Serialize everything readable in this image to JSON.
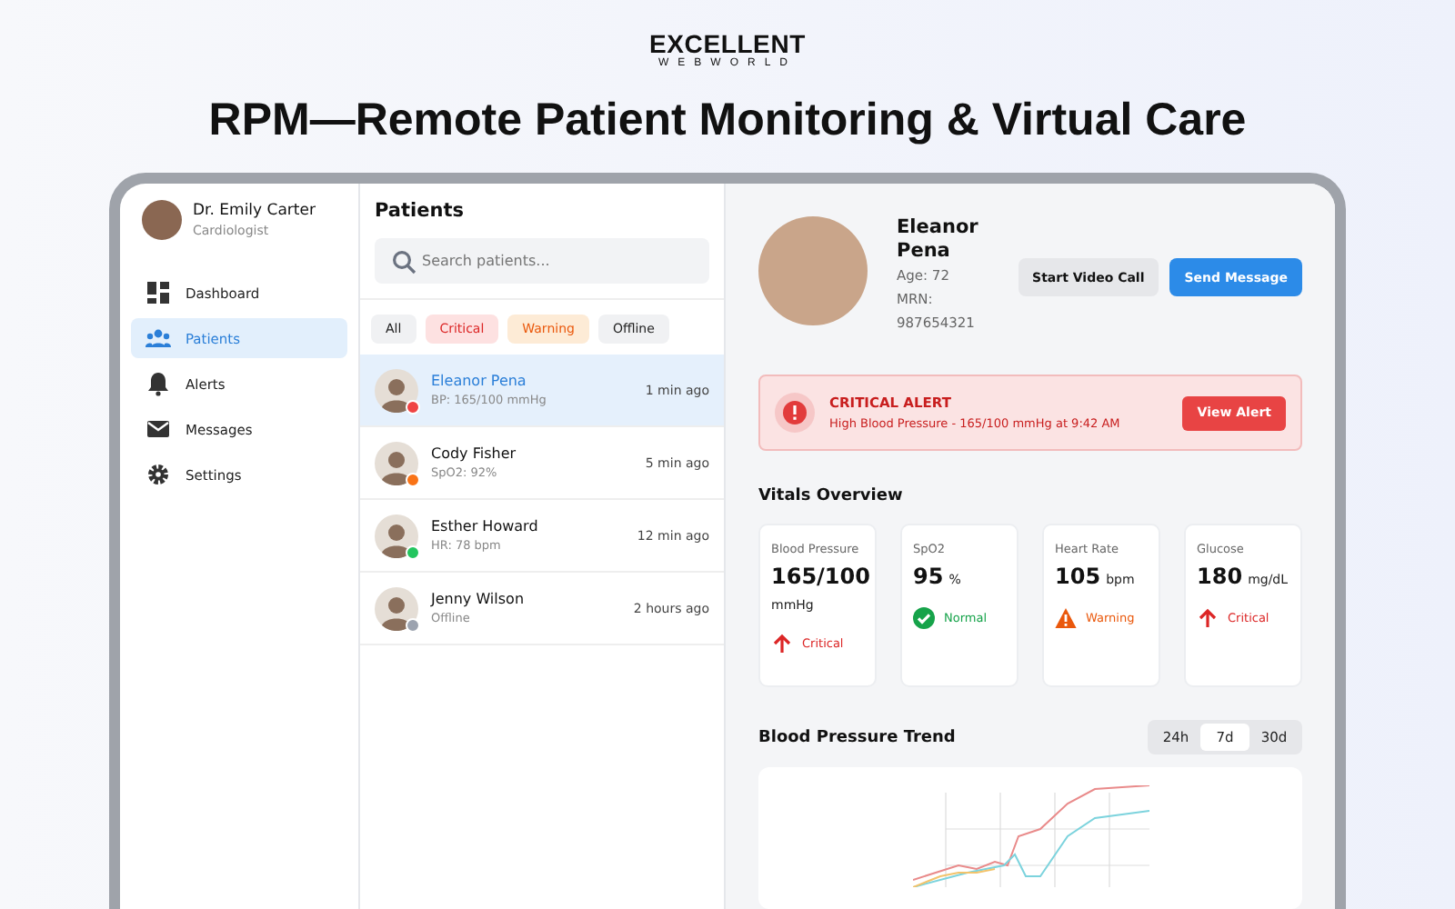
{
  "brand": {
    "name": "EXCELLENT",
    "tagline": "WEBWORLD"
  },
  "headline": "RPM—Remote Patient Monitoring & Virtual Care",
  "doctor": {
    "name": "Dr. Emily Carter",
    "role": "Cardiologist"
  },
  "sidebar": {
    "items": [
      {
        "label": "Dashboard",
        "kind": "dashboard",
        "selected": false
      },
      {
        "label": "Patients",
        "kind": "patients",
        "selected": true
      },
      {
        "label": "Alerts",
        "kind": "alerts",
        "selected": false
      },
      {
        "label": "Messages",
        "kind": "messages",
        "selected": false
      },
      {
        "label": "Settings",
        "kind": "settings",
        "selected": false
      }
    ]
  },
  "patients": {
    "title": "Patients",
    "search": {
      "placeholder": "Search patients..."
    },
    "filters": [
      {
        "label": "All",
        "kind": "neutral"
      },
      {
        "label": "Critical",
        "kind": "critical"
      },
      {
        "label": "Warning",
        "kind": "warning"
      },
      {
        "label": "Offline",
        "kind": "neutral"
      }
    ],
    "rows": [
      {
        "name": "Eleanor Pena",
        "detail": "BP: 165/100 mmHg",
        "time": "1 min ago",
        "color": "#ef4444",
        "selected": true
      },
      {
        "name": "Cody Fisher",
        "detail": "SpO2: 92%",
        "time": "5 min ago",
        "color": "#f97316",
        "selected": false
      },
      {
        "name": "Esther Howard",
        "detail": "HR: 78 bpm",
        "time": "12 min ago",
        "color": "#22c55e",
        "selected": false
      },
      {
        "name": "Jenny Wilson",
        "detail": "Offline",
        "time": "2 hours ago",
        "color": "#9ca3af",
        "selected": false
      }
    ]
  },
  "detail": {
    "name": "Eleanor Pena",
    "age": "Age: 72",
    "mrn": "MRN: 987654321",
    "buttons": [
      {
        "label": "Start Video Call",
        "kind": "secondary"
      },
      {
        "label": "Send Message",
        "kind": "primary"
      }
    ],
    "alert": {
      "title": "CRITICAL ALERT",
      "message": "High Blood Pressure - 165/100 mmHg at 9:42 AM",
      "button": "View Alert"
    },
    "vitals_title": "Vitals Overview",
    "vitals": [
      {
        "label": "Blood Pressure",
        "value": "165/100",
        "unit": "mmHg",
        "kind": "critical",
        "status": "Critical"
      },
      {
        "label": "SpO2",
        "value": "95",
        "unit": "%",
        "kind": "normal",
        "status": "Normal"
      },
      {
        "label": "Heart Rate",
        "value": "105",
        "unit": "bpm",
        "kind": "warning",
        "status": "Warning"
      },
      {
        "label": "Glucose",
        "value": "180",
        "unit": "mg/dL",
        "kind": "critical",
        "status": "Critical"
      }
    ],
    "trend": {
      "title": "Blood Pressure Trend",
      "ranges": [
        {
          "label": "24h",
          "selected": false
        },
        {
          "label": "7d",
          "selected": true
        },
        {
          "label": "30d",
          "selected": false
        }
      ]
    }
  }
}
